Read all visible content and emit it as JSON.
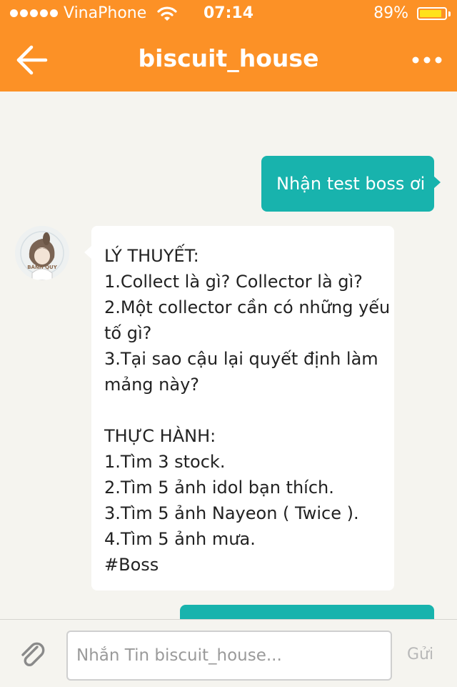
{
  "status_bar": {
    "carrier": "VinaPhone",
    "time": "07:14",
    "battery_percent": "89%",
    "battery_level": 0.89,
    "battery_fill_color": "#ffe21a"
  },
  "nav": {
    "title": "biscuit_house",
    "back_icon": "arrow-left-icon",
    "more_icon": "more-horizontal-icon",
    "bar_color": "#fc9126"
  },
  "messages": {
    "outgoing_1": "Nhận test boss ơi",
    "incoming_lines": [
      "LÝ THUYẾT:",
      "1.Collect là gì? Collector là gì?",
      "2.Một collector cần có những yếu",
      "tố gì?",
      "3.Tại sao cậu lại quyết định làm",
      "mảng này?",
      "",
      "THỰC HÀNH:",
      "1.Tìm 3 stock.",
      "2.Tìm 5 ảnh idol bạn thích.",
      "3.Tìm 5 ảnh Nayeon ( Twice ).",
      "4.Tìm 5 ảnh mưa.",
      "#Boss"
    ],
    "outgoing_color": "#18b3ad",
    "avatar_text": "BÁNH QUY"
  },
  "composer": {
    "placeholder": "Nhắn Tin biscuit_house...",
    "send_label": "Gửi",
    "attach_icon": "paperclip-icon"
  }
}
